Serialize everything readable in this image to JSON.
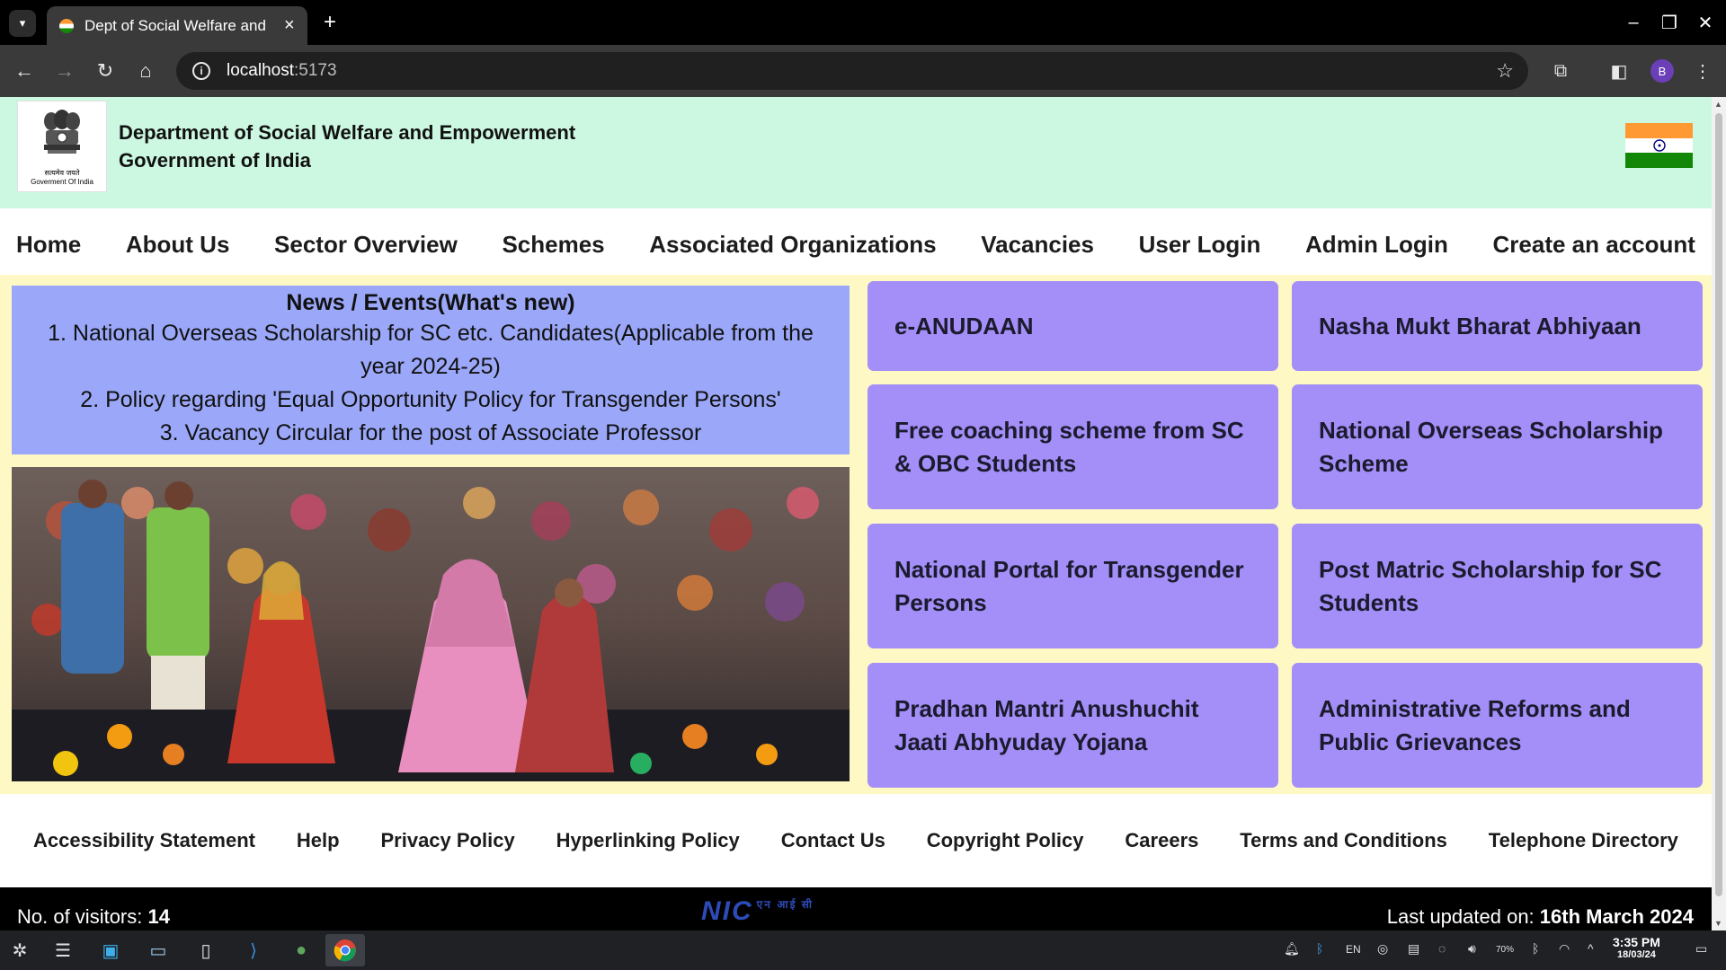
{
  "browser": {
    "tab_title": "Dept of Social Welfare and",
    "url_host": "localhost",
    "url_port": ":5173",
    "profile_initial": "B"
  },
  "header": {
    "emblem_caption": "Goverment Of India",
    "emblem_motto": "सत्यमेव जयते",
    "title_line1": "Department of Social Welfare and Empowerment",
    "title_line2": "Government of India"
  },
  "nav": {
    "items": [
      "Home",
      "About Us",
      "Sector Overview",
      "Schemes",
      "Associated Organizations",
      "Vacancies",
      "User Login",
      "Admin Login",
      "Create an account"
    ]
  },
  "news": {
    "title": "News / Events(What's new)",
    "items": [
      "1. National Overseas Scholarship for SC etc. Candidates(Applicable from the year 2024-25)",
      "2. Policy regarding 'Equal Opportunity Policy for Transgender Persons'",
      "3. Vacancy Circular for the post of Associate Professor"
    ]
  },
  "schemes": [
    "e-ANUDAAN",
    "Nasha Mukt Bharat Abhiyaan",
    "Free coaching scheme from SC & OBC Students",
    "National Overseas Scholarship Scheme",
    "National Portal for Transgender Persons",
    "Post Matric Scholarship for SC Students",
    "Pradhan Mantri Anushuchit Jaati Abhyuday Yojana",
    "Administrative Reforms and Public Grievances"
  ],
  "footer": {
    "links": [
      "Accessibility Statement",
      "Help",
      "Privacy Policy",
      "Hyperlinking Policy",
      "Contact Us",
      "Copyright Policy",
      "Careers",
      "Terms and Conditions",
      "Telephone Directory"
    ],
    "visitors_label": "No. of visitors:",
    "visitors_count": "14",
    "nic_logo": "NIC",
    "nic_hindi": "एन आई सी",
    "updated_label": "Last updated on:",
    "updated_date": "16th March 2024"
  },
  "taskbar": {
    "lang": "EN",
    "battery": "70%",
    "time": "3:35 PM",
    "date": "18/03/24"
  },
  "colors": {
    "header_bg": "#ccf7e1",
    "content_bg": "#fdf8c4",
    "news_bg": "#9ba8f9",
    "card_bg": "#a48ef8"
  }
}
